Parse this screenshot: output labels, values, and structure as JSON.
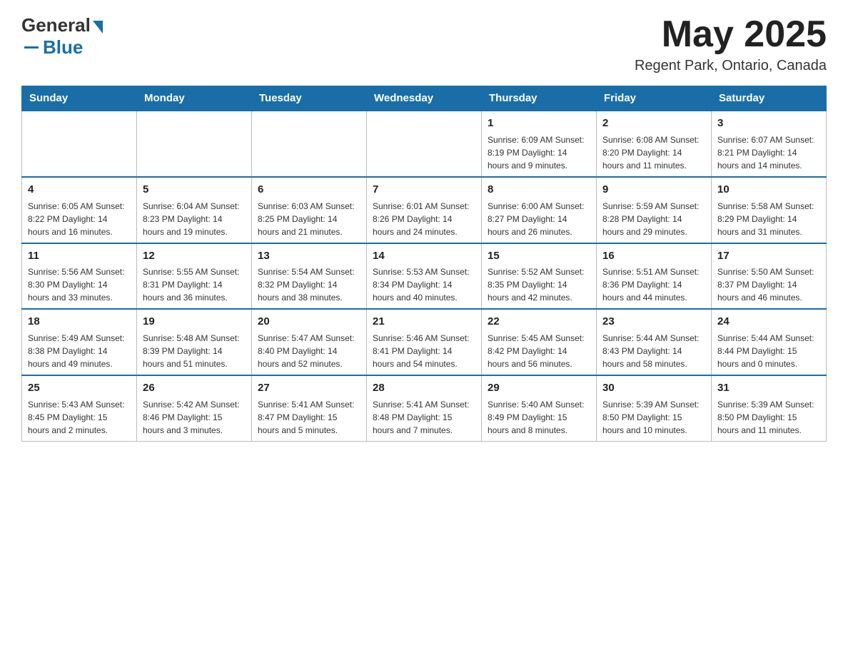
{
  "header": {
    "logo_general": "General",
    "logo_blue": "Blue",
    "month_title": "May 2025",
    "location": "Regent Park, Ontario, Canada"
  },
  "weekdays": [
    "Sunday",
    "Monday",
    "Tuesday",
    "Wednesday",
    "Thursday",
    "Friday",
    "Saturday"
  ],
  "weeks": [
    [
      {
        "day": "",
        "info": ""
      },
      {
        "day": "",
        "info": ""
      },
      {
        "day": "",
        "info": ""
      },
      {
        "day": "",
        "info": ""
      },
      {
        "day": "1",
        "info": "Sunrise: 6:09 AM\nSunset: 8:19 PM\nDaylight: 14 hours and 9 minutes."
      },
      {
        "day": "2",
        "info": "Sunrise: 6:08 AM\nSunset: 8:20 PM\nDaylight: 14 hours and 11 minutes."
      },
      {
        "day": "3",
        "info": "Sunrise: 6:07 AM\nSunset: 8:21 PM\nDaylight: 14 hours and 14 minutes."
      }
    ],
    [
      {
        "day": "4",
        "info": "Sunrise: 6:05 AM\nSunset: 8:22 PM\nDaylight: 14 hours and 16 minutes."
      },
      {
        "day": "5",
        "info": "Sunrise: 6:04 AM\nSunset: 8:23 PM\nDaylight: 14 hours and 19 minutes."
      },
      {
        "day": "6",
        "info": "Sunrise: 6:03 AM\nSunset: 8:25 PM\nDaylight: 14 hours and 21 minutes."
      },
      {
        "day": "7",
        "info": "Sunrise: 6:01 AM\nSunset: 8:26 PM\nDaylight: 14 hours and 24 minutes."
      },
      {
        "day": "8",
        "info": "Sunrise: 6:00 AM\nSunset: 8:27 PM\nDaylight: 14 hours and 26 minutes."
      },
      {
        "day": "9",
        "info": "Sunrise: 5:59 AM\nSunset: 8:28 PM\nDaylight: 14 hours and 29 minutes."
      },
      {
        "day": "10",
        "info": "Sunrise: 5:58 AM\nSunset: 8:29 PM\nDaylight: 14 hours and 31 minutes."
      }
    ],
    [
      {
        "day": "11",
        "info": "Sunrise: 5:56 AM\nSunset: 8:30 PM\nDaylight: 14 hours and 33 minutes."
      },
      {
        "day": "12",
        "info": "Sunrise: 5:55 AM\nSunset: 8:31 PM\nDaylight: 14 hours and 36 minutes."
      },
      {
        "day": "13",
        "info": "Sunrise: 5:54 AM\nSunset: 8:32 PM\nDaylight: 14 hours and 38 minutes."
      },
      {
        "day": "14",
        "info": "Sunrise: 5:53 AM\nSunset: 8:34 PM\nDaylight: 14 hours and 40 minutes."
      },
      {
        "day": "15",
        "info": "Sunrise: 5:52 AM\nSunset: 8:35 PM\nDaylight: 14 hours and 42 minutes."
      },
      {
        "day": "16",
        "info": "Sunrise: 5:51 AM\nSunset: 8:36 PM\nDaylight: 14 hours and 44 minutes."
      },
      {
        "day": "17",
        "info": "Sunrise: 5:50 AM\nSunset: 8:37 PM\nDaylight: 14 hours and 46 minutes."
      }
    ],
    [
      {
        "day": "18",
        "info": "Sunrise: 5:49 AM\nSunset: 8:38 PM\nDaylight: 14 hours and 49 minutes."
      },
      {
        "day": "19",
        "info": "Sunrise: 5:48 AM\nSunset: 8:39 PM\nDaylight: 14 hours and 51 minutes."
      },
      {
        "day": "20",
        "info": "Sunrise: 5:47 AM\nSunset: 8:40 PM\nDaylight: 14 hours and 52 minutes."
      },
      {
        "day": "21",
        "info": "Sunrise: 5:46 AM\nSunset: 8:41 PM\nDaylight: 14 hours and 54 minutes."
      },
      {
        "day": "22",
        "info": "Sunrise: 5:45 AM\nSunset: 8:42 PM\nDaylight: 14 hours and 56 minutes."
      },
      {
        "day": "23",
        "info": "Sunrise: 5:44 AM\nSunset: 8:43 PM\nDaylight: 14 hours and 58 minutes."
      },
      {
        "day": "24",
        "info": "Sunrise: 5:44 AM\nSunset: 8:44 PM\nDaylight: 15 hours and 0 minutes."
      }
    ],
    [
      {
        "day": "25",
        "info": "Sunrise: 5:43 AM\nSunset: 8:45 PM\nDaylight: 15 hours and 2 minutes."
      },
      {
        "day": "26",
        "info": "Sunrise: 5:42 AM\nSunset: 8:46 PM\nDaylight: 15 hours and 3 minutes."
      },
      {
        "day": "27",
        "info": "Sunrise: 5:41 AM\nSunset: 8:47 PM\nDaylight: 15 hours and 5 minutes."
      },
      {
        "day": "28",
        "info": "Sunrise: 5:41 AM\nSunset: 8:48 PM\nDaylight: 15 hours and 7 minutes."
      },
      {
        "day": "29",
        "info": "Sunrise: 5:40 AM\nSunset: 8:49 PM\nDaylight: 15 hours and 8 minutes."
      },
      {
        "day": "30",
        "info": "Sunrise: 5:39 AM\nSunset: 8:50 PM\nDaylight: 15 hours and 10 minutes."
      },
      {
        "day": "31",
        "info": "Sunrise: 5:39 AM\nSunset: 8:50 PM\nDaylight: 15 hours and 11 minutes."
      }
    ]
  ]
}
